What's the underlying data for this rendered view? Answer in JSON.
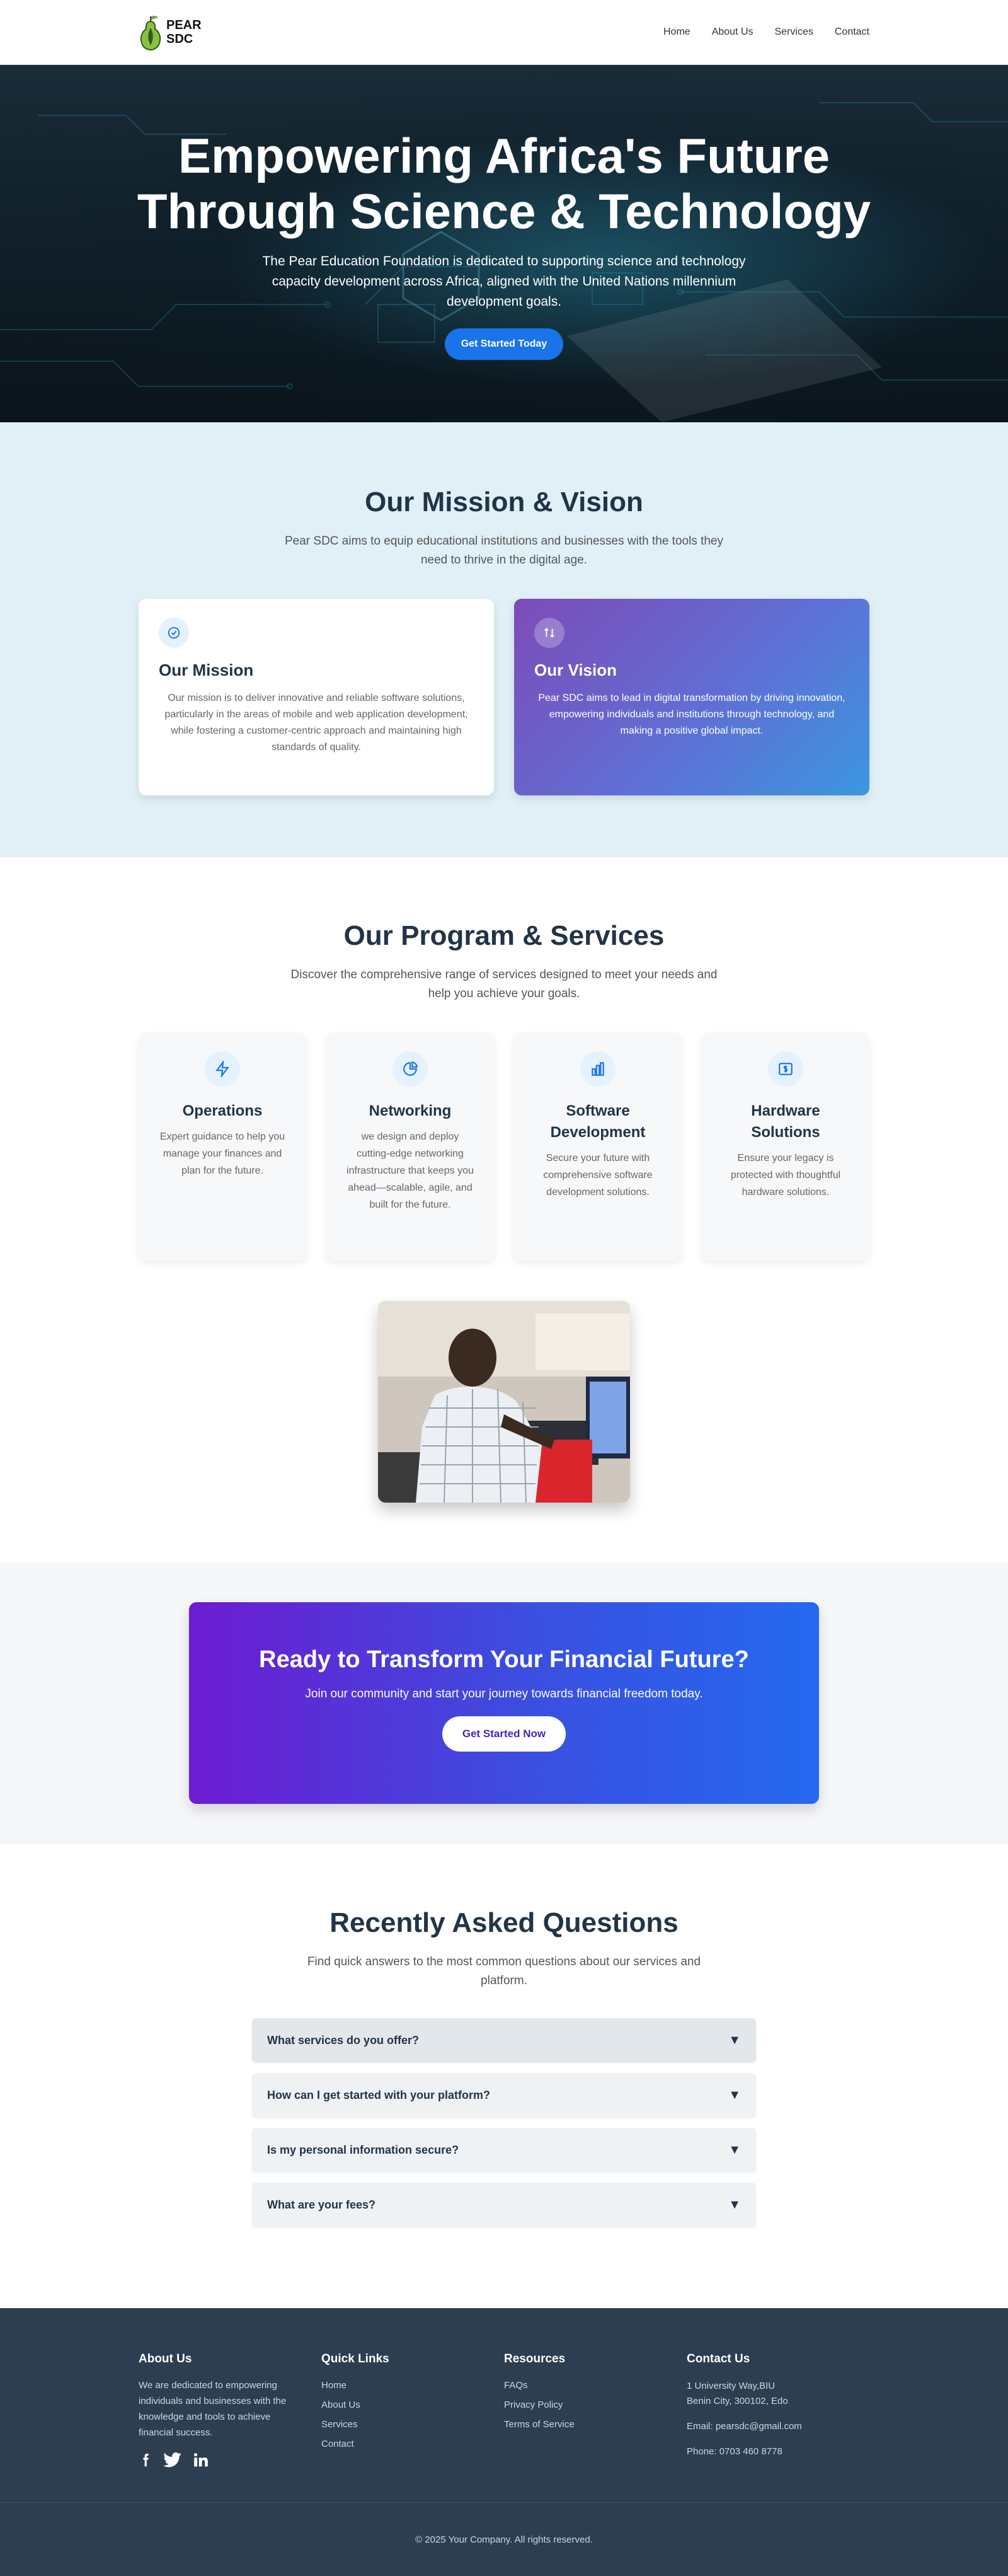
{
  "nav": {
    "logo_line1": "PEAR",
    "logo_line2": "SDC",
    "links": [
      "Home",
      "About Us",
      "Services",
      "Contact"
    ]
  },
  "hero": {
    "title": "Empowering Africa's Future Through Science & Technology",
    "subtitle": "The Pear Education Foundation is dedicated to supporting science and technology capacity development across Africa, aligned with the United Nations millennium development goals.",
    "cta": "Get Started Today"
  },
  "mission": {
    "title": "Our Mission & Vision",
    "subtitle": "Pear SDC aims to equip educational institutions and businesses with the tools they need to thrive in the digital age.",
    "cards": [
      {
        "icon": "check-circle-icon",
        "title": "Our Mission",
        "text": "Our mission is to deliver innovative and reliable software solutions, particularly in the areas of mobile and web application development, while fostering a customer-centric approach and maintaining high standards of quality."
      },
      {
        "icon": "sort-icon",
        "title": "Our Vision",
        "text": "Pear SDC aims to lead in digital transformation by driving innovation, empowering individuals and institutions through technology, and making a positive global impact."
      }
    ]
  },
  "services": {
    "title": "Our Program & Services",
    "subtitle": "Discover the comprehensive range of services designed to meet your needs and help you achieve your goals.",
    "items": [
      {
        "icon": "lightning-icon",
        "title": "Operations",
        "text": "Expert guidance to help you manage your finances and plan for the future."
      },
      {
        "icon": "pie-chart-icon",
        "title": "Networking",
        "text": "we design and deploy cutting-edge networking infrastructure that keeps you ahead—scalable, agile, and built for the future."
      },
      {
        "icon": "bar-chart-icon",
        "title": "Software Development",
        "text": "Secure your future with comprehensive software development solutions."
      },
      {
        "icon": "dollar-icon",
        "title": "Hardware Solutions",
        "text": "Ensure your legacy is protected with thoughtful hardware solutions."
      }
    ]
  },
  "cta": {
    "title": "Ready to Transform Your Financial Future?",
    "subtitle": "Join our community and start your journey towards financial freedom today.",
    "button": "Get Started Now"
  },
  "faq": {
    "title": "Recently Asked Questions",
    "subtitle": "Find quick answers to the most common questions about our services and platform.",
    "arrow": "▼",
    "items": [
      "What services do you offer?",
      "How can I get started with your platform?",
      "Is my personal information secure?",
      "What are your fees?"
    ]
  },
  "footer": {
    "about": {
      "title": "About Us",
      "text": "We are dedicated to empowering individuals and businesses with the knowledge and tools to achieve financial success."
    },
    "quick": {
      "title": "Quick Links",
      "links": [
        "Home",
        "About Us",
        "Services",
        "Contact"
      ]
    },
    "resources": {
      "title": "Resources",
      "links": [
        "FAQs",
        "Privacy Policy",
        "Terms of Service"
      ]
    },
    "contact": {
      "title": "Contact Us",
      "address1": "1 University Way,BIU",
      "address2": "Benin City, 300102, Edo",
      "email": "Email: pearsdc@gmail.com",
      "phone": "Phone: 0703 460 8778"
    },
    "copyright": "© 2025 Your Company. All rights reserved."
  }
}
